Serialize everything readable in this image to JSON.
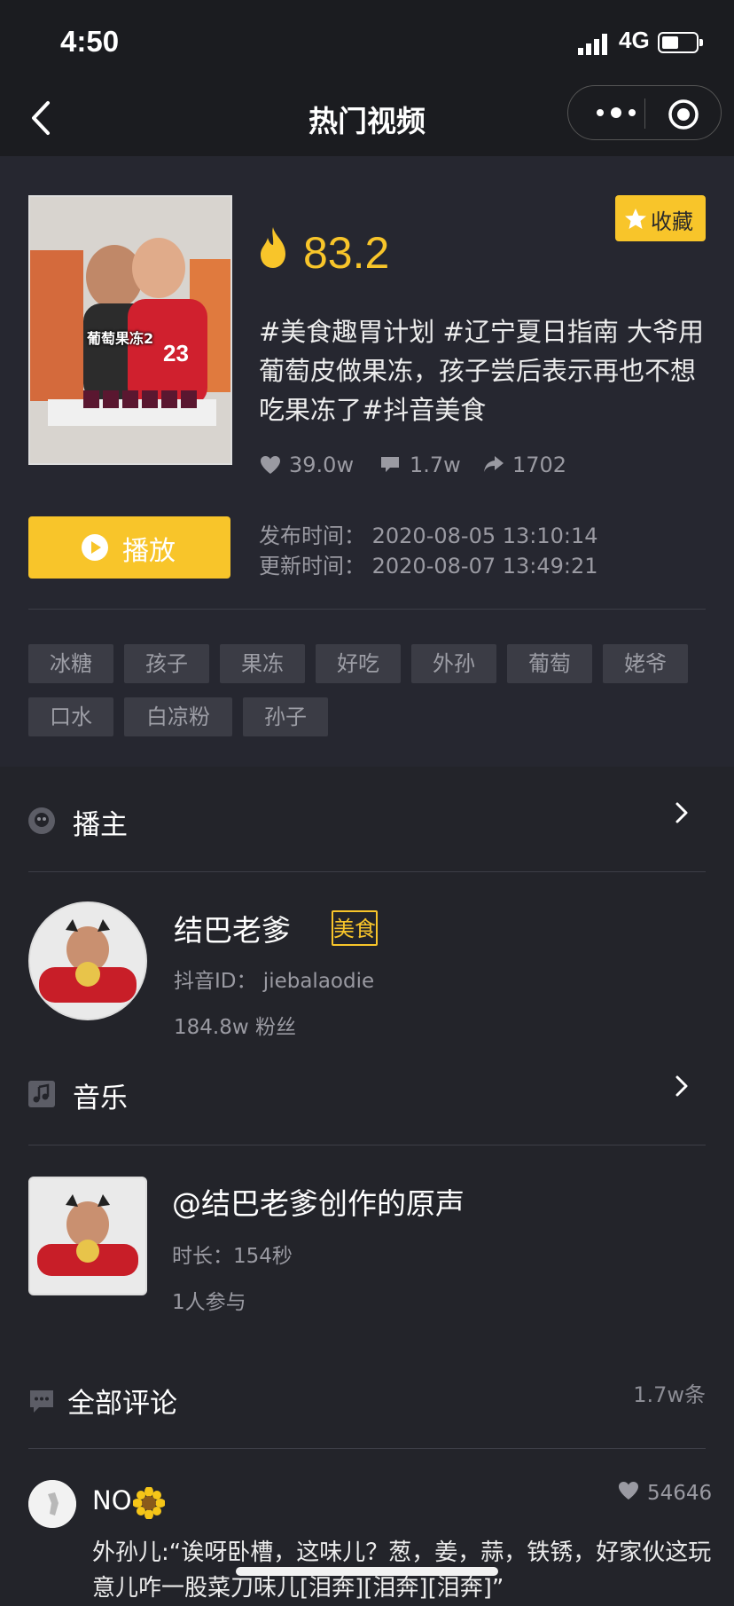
{
  "status": {
    "time": "4:50",
    "network": "4G"
  },
  "nav": {
    "title": "热门视频"
  },
  "video": {
    "thumb_caption": "葡萄果冻2",
    "favorite_label": "收藏",
    "score": "83.2",
    "description": "#美食趣胃计划 #辽宁夏日指南 大爷用葡萄皮做果冻，孩子尝后表示再也不想吃果冻了#抖音美食",
    "likes": "39.0w",
    "comments": "1.7w",
    "shares": "1702",
    "play_label": "播放",
    "publish_time": "发布时间：  2020-08-05 13:10:14",
    "update_time": "更新时间：  2020-08-07 13:49:21",
    "tags": [
      "冰糖",
      "孩子",
      "果冻",
      "好吃",
      "外孙",
      "葡萄",
      "姥爷",
      "口水",
      "白凉粉",
      "孙子"
    ]
  },
  "host": {
    "section_title": "播主",
    "name": "结巴老爹",
    "category": "美食",
    "douyin_id": "抖音ID：  jiebalaodie",
    "fans": "184.8w 粉丝"
  },
  "music": {
    "section_title": "音乐",
    "title": "@结巴老爹创作的原声",
    "duration": "时长：154秒",
    "participants": "1人参与"
  },
  "comments": {
    "section_title": "全部评论",
    "total": "1.7w条",
    "items": [
      {
        "user": "NO",
        "likes": "54646",
        "text": "外孙儿:“诶呀卧槽，这味儿？葱，姜，蒜，铁锈，好家伙这玩意儿咋一股菜刀味儿[泪奔][泪奔][泪奔]”"
      }
    ]
  },
  "colors": {
    "accent": "#f8c52a",
    "background": "#222329",
    "card": "#262730",
    "tag_bg": "#3b3c45"
  }
}
